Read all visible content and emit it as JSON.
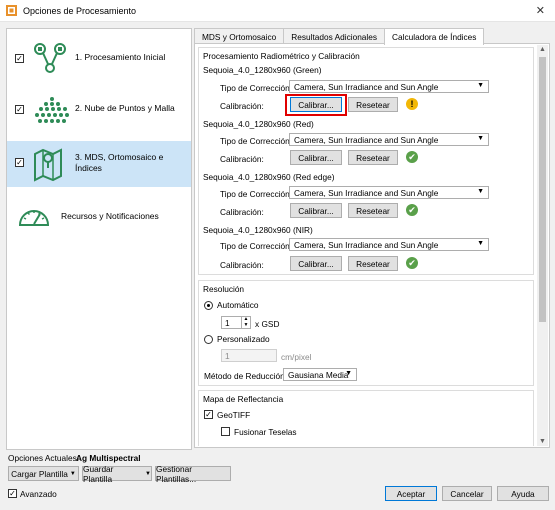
{
  "window": {
    "title": "Opciones de Procesamiento",
    "close_glyph": "✕"
  },
  "steps": [
    {
      "label": "1. Procesamiento Inicial",
      "icon": "initial-processing-icon",
      "checked": true
    },
    {
      "label": "2. Nube de Puntos y Malla",
      "icon": "point-cloud-icon",
      "checked": true
    },
    {
      "label_line1": "3. MDS, Ortomosaico e",
      "label_line2": "Índices",
      "icon": "map-icon",
      "checked": true
    },
    {
      "label": "Recursos y Notificaciones",
      "icon": "gauge-icon"
    }
  ],
  "tabs": [
    "MDS y Ortomosaico",
    "Resultados Adicionales",
    "Calculadora de Índices"
  ],
  "radiometric": {
    "title": "Procesamiento Radiométrico y Calibración",
    "correction_label": "Tipo de Corrección:",
    "calibration_label": "Calibración:",
    "calibrate_label": "Calibrar...",
    "reset_label": "Resetear",
    "cameras": [
      {
        "name": "Sequoia_4.0_1280x960 (Green)",
        "correction": "Camera, Sun Irradiance and Sun Angle",
        "status": "warning"
      },
      {
        "name": "Sequoia_4.0_1280x960 (Red)",
        "correction": "Camera, Sun Irradiance and Sun Angle",
        "status": "ok"
      },
      {
        "name": "Sequoia_4.0_1280x960 (Red edge)",
        "correction": "Camera, Sun Irradiance and Sun Angle",
        "status": "ok"
      },
      {
        "name": "Sequoia_4.0_1280x960 (NIR)",
        "correction": "Camera, Sun Irradiance and Sun Angle",
        "status": "ok"
      }
    ],
    "warning_glyph": "!",
    "ok_glyph": "✔"
  },
  "resolution": {
    "title": "Resolución",
    "auto_label": "Automático",
    "auto_value": "1",
    "gsd_label": "x GSD",
    "custom_label": "Personalizado",
    "custom_value": "1",
    "custom_unit": "cm/pixel",
    "reduction_label": "Método de Reducción:",
    "reduction_value": "Gausiana Media"
  },
  "reflectance": {
    "title": "Mapa de Reflectancia",
    "geotiff_label": "GeoTIFF",
    "merge_label": "Fusionar Teselas"
  },
  "footer": {
    "current_label": "Opciones Actuales:",
    "current_value": "Ag Multispectral",
    "load_label": "Cargar Plantilla",
    "save_label": "Guardar Plantilla",
    "manage_label": "Gestionar Plantillas...",
    "advanced_label": "Avanzado",
    "accept_label": "Aceptar",
    "cancel_label": "Cancelar",
    "help_label": "Ayuda"
  },
  "colors": {
    "selected": "#cce4f7",
    "accent": "#0078d7",
    "highlight": "#e00000",
    "warning": "#f2b705",
    "ok": "#5aa04a",
    "icon_green": "#2e8b57"
  }
}
